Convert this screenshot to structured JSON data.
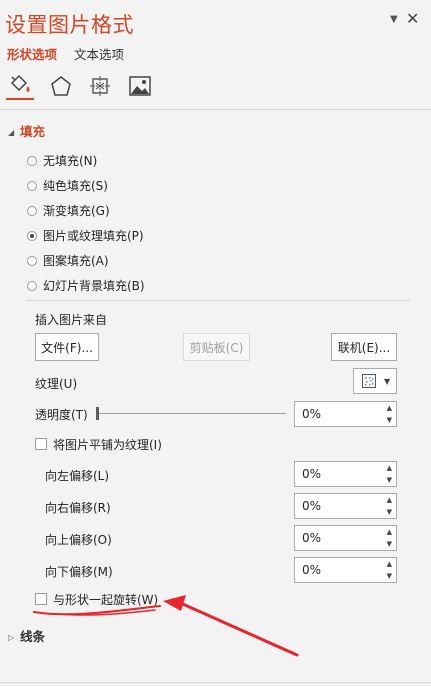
{
  "pane": {
    "title": "设置图片格式",
    "tab_shape": "形状选项",
    "tab_text": "文本选项"
  },
  "icons": [
    "fill-line-icon",
    "effects-icon",
    "size-properties-icon",
    "picture-icon"
  ],
  "fill": {
    "header": "填充",
    "options": [
      "无填充(N)",
      "纯色填充(S)",
      "渐变填充(G)",
      "图片或纹理填充(P)",
      "图案填充(A)",
      "幻灯片背景填充(B)"
    ],
    "selected": "图片或纹理填充(P)",
    "insert_from": "插入图片来自",
    "file_btn": "文件(F)...",
    "clipboard_btn": "剪贴板(C)",
    "online_btn": "联机(E)...",
    "texture_label": "纹理(U)",
    "transparency_label": "透明度(T)",
    "transparency_value": "0%",
    "tile_label": "将图片平铺为纹理(I)",
    "offset_left_label": "向左偏移(L)",
    "offset_left": "0%",
    "offset_right_label": "向右偏移(R)",
    "offset_right": "0%",
    "offset_top_label": "向上偏移(O)",
    "offset_top": "0%",
    "offset_bottom_label": "向下偏移(M)",
    "offset_bottom": "0%",
    "rotate_label": "与形状一起旋转(W)"
  },
  "line": {
    "header": "线条"
  },
  "colors": {
    "accent": "#d24726",
    "annotation": "#e8242c"
  }
}
